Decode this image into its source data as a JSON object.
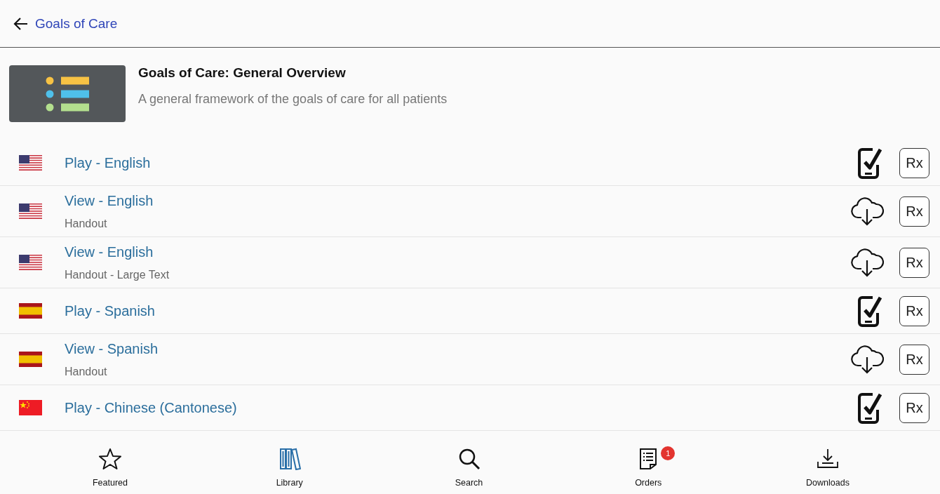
{
  "header": {
    "title": "Goals of Care"
  },
  "overview": {
    "title": "Goals of Care: General Overview",
    "description": "A general framework of the goals of care for all patients"
  },
  "items": [
    {
      "title": "Play - English",
      "flag": {
        "kind": "us"
      },
      "kind": "device",
      "action": "Rx"
    },
    {
      "title": "View - English",
      "subtitle": "Handout",
      "flag": {
        "kind": "us"
      },
      "kind": "download",
      "action": "Rx"
    },
    {
      "title": "View - English",
      "subtitle": "Handout - Large Text",
      "flag": {
        "kind": "us"
      },
      "kind": "download",
      "action": "Rx"
    },
    {
      "title": "Play - Spanish",
      "flag": {
        "kind": "es"
      },
      "kind": "device",
      "action": "Rx"
    },
    {
      "title": "View - Spanish",
      "subtitle": "Handout",
      "flag": {
        "kind": "es"
      },
      "kind": "download",
      "action": "Rx"
    },
    {
      "title": "Play - Chinese (Cantonese)",
      "flag": {
        "kind": "cn"
      },
      "kind": "device",
      "action": "Rx"
    }
  ],
  "nav": [
    {
      "label": "Featured",
      "kind": "star",
      "selected": false
    },
    {
      "label": "Library",
      "kind": "books",
      "selected": true
    },
    {
      "label": "Search",
      "kind": "search",
      "selected": false
    },
    {
      "label": "Orders",
      "kind": "orders",
      "selected": false,
      "badge": "1"
    },
    {
      "label": "Downloads",
      "kind": "downloads",
      "selected": false
    }
  ]
}
